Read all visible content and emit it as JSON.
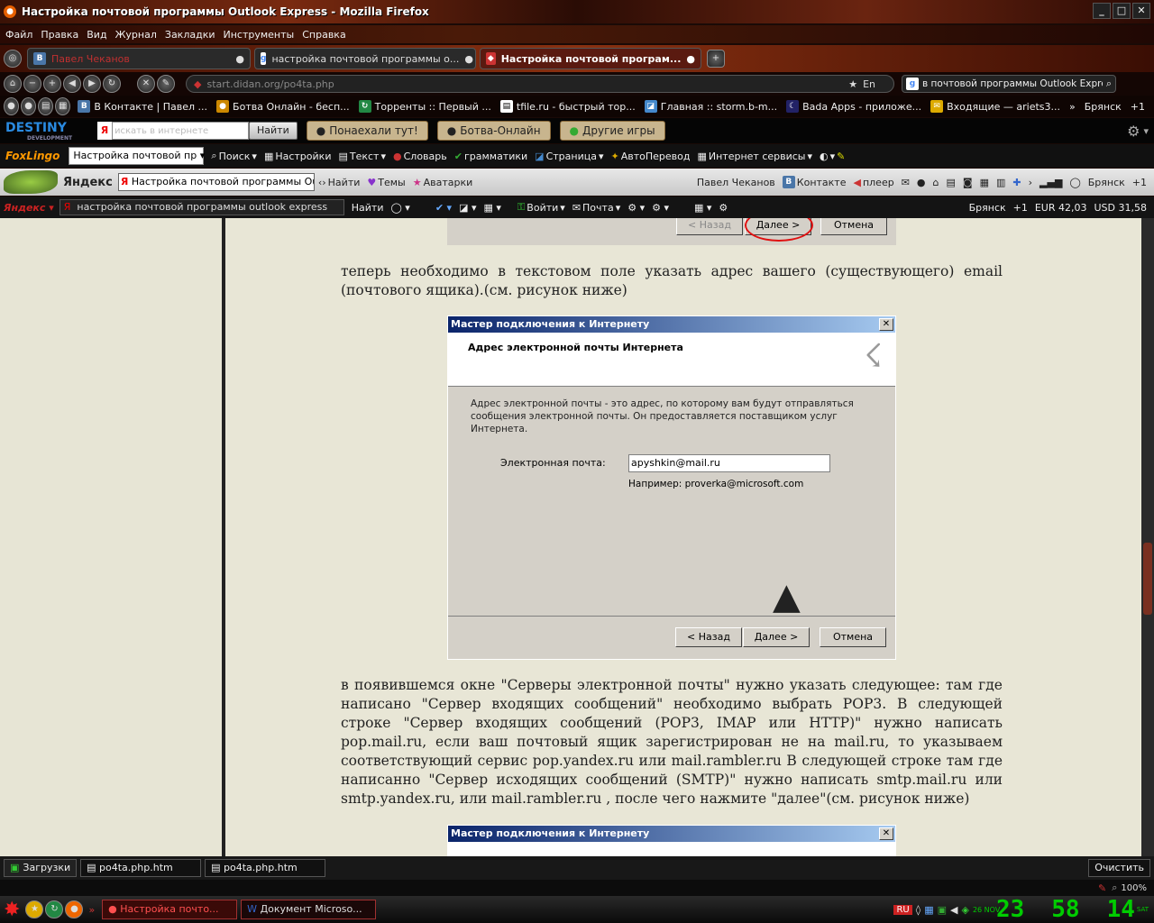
{
  "window": {
    "title": "Настройка почтовой программы Outlook Express - Mozilla Firefox"
  },
  "menu": [
    "Файл",
    "Правка",
    "Вид",
    "Журнал",
    "Закладки",
    "Инструменты",
    "Справка"
  ],
  "tabs": [
    {
      "label": "Павел Чеканов",
      "icon": "vk-icon"
    },
    {
      "label": "настройка почтовой программы о...",
      "icon": "google-icon"
    },
    {
      "label": "Настройка почтовой програм...",
      "icon": "firefox-icon",
      "active": true
    }
  ],
  "nav": {
    "url": "start.didan.org/po4ta.php",
    "lang": "En",
    "search": "в почтовой программы Outlook Express"
  },
  "bookmarks": [
    "В Контакте | Павел ...",
    "Ботва Онлайн - бесп...",
    "Торренты :: Первый ...",
    "tfile.ru - быстрый тор...",
    "Главная :: storm.b-m...",
    "Bada Apps - приложе...",
    "Входящие — ariets3...",
    "Брянск",
    "+1"
  ],
  "destiny": {
    "logo": "DESTINY",
    "sub": "DEVELOPMENT",
    "placeholder": "искать в интернете",
    "find": "Найти",
    "btn1": "Понаехали тут!",
    "btn2": "Ботва-Онлайн",
    "btn3": "Другие игры"
  },
  "foxlingo": {
    "logo": "FoxLingo",
    "select": "Настройка почтовой пр",
    "items": [
      "Поиск",
      "Настройки",
      "Текст",
      "Словарь",
      "грамматики",
      "Страница",
      "АвтоПеревод",
      "Интернет сервисы"
    ]
  },
  "yandex": {
    "logo": "Яндекс",
    "input": "Настройка почтовой программы Outloo",
    "find": "Найти",
    "themes": "Темы",
    "avatars": "Аватарки",
    "user": "Павел Чеканов",
    "vk": "Контакте",
    "player": "плеер",
    "city": "Брянск",
    "temp": "+1"
  },
  "bar7": {
    "query": "настройка почтовой программы outlook express",
    "find": "Найти",
    "login": "Войти",
    "mail": "Почта",
    "city": "Брянск",
    "temp": "+1",
    "eur": "EUR 42,03",
    "usd": "USD 31,58"
  },
  "page": {
    "top_buttons": [
      "< Назад",
      "Далее >",
      "Отмена"
    ],
    "para1": "теперь необходимо в текстовом поле указать адрес вашего (существующего) email (почтового ящика).(см. рисунок ниже)",
    "dialog": {
      "title": "Мастер подключения к Интернету",
      "heading": "Адрес электронной почты Интернета",
      "desc": "Адрес электронной почты - это адрес, по которому вам будут отправляться сообщения электронной почты. Он предоставляется поставщиком услуг Интернета.",
      "email_label": "Электронная почта:",
      "email_value": "apyshkin@mail.ru",
      "example": "Например: proverka@microsoft.com",
      "back": "< Назад",
      "next": "Далее >",
      "cancel": "Отмена"
    },
    "para2": "в появившемся окне \"Серверы электронной почты\" нужно указать следующее: там где написано \"Сервер входящих сообщений\" необходимо выбрать POP3. В следующей строке \"Сервер входящих сообщений (POP3, IMAP или HTTP)\" нужно написать pop.mail.ru, если ваш почтовый ящик зарегистрирован не на mail.ru, то указываем соответствующий сервис pop.yandex.ru или mail.rambler.ru В следующей строке там где написанно \"Сервер исходящих сообщений (SMTP)\" нужно написать smtp.mail.ru или smtp.yandex.ru, или mail.rambler.ru , после чего нажмите \"далее\"(см. рисунок ниже)",
    "dialog2_title": "Мастер подключения к Интернету"
  },
  "downloads": {
    "label": "Загрузки",
    "items": [
      "po4ta.php.htm",
      "po4ta.php.htm"
    ],
    "clear": "Очистить"
  },
  "status": {
    "zoom": "100%"
  },
  "taskbar": {
    "tasks": [
      "Настройка почто...",
      "Документ Microso..."
    ],
    "lang": "RU",
    "date": "26 NOV",
    "clock": [
      "23",
      "58",
      "14"
    ],
    "day": "SAT"
  }
}
